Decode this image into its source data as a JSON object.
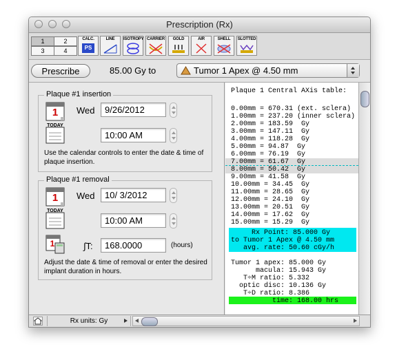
{
  "window": {
    "title": "Prescription (Rx)"
  },
  "toolbar": {
    "numbers": [
      "1",
      "2",
      "3",
      "4"
    ],
    "tools": [
      {
        "label": "CALC.",
        "sub": "PS",
        "icon": "calc-ps-icon"
      },
      {
        "label": "LINE",
        "icon": "line-icon"
      },
      {
        "label": "ISOTROPY",
        "icon": "isotropy-icon"
      },
      {
        "label": "CARRIER",
        "icon": "carrier-icon"
      },
      {
        "label": "GOLD",
        "icon": "gold-icon"
      },
      {
        "label": "AIR",
        "icon": "air-icon"
      },
      {
        "label": "SHELL",
        "icon": "shell-icon"
      },
      {
        "label": "SLOTTED",
        "icon": "slotted-icon"
      }
    ]
  },
  "rx": {
    "prescribe_label": "Prescribe",
    "dose_text": "85.00  Gy to",
    "target": "Tumor 1 Apex @ 4.50 mm"
  },
  "insertion": {
    "title": "Plaque #1 insertion",
    "weekday": "Wed",
    "date": "9/26/2012",
    "time": "10:00 AM",
    "cal_day": "1",
    "today_label": "TODAY",
    "help": "Use the calendar controls to enter the date & time of plaque insertion."
  },
  "removal": {
    "title": "Plaque #1 removal",
    "weekday": "Wed",
    "date": "10/ 3/2012",
    "time": "10:00 AM",
    "cal_day": "1",
    "today_label": "TODAY",
    "duration_label": "∫T:",
    "duration": "168.0000",
    "duration_unit": "(hours)",
    "help": "Adjust the date & time of removal or enter the desired implant duration in hours."
  },
  "axis_table": {
    "title": "Plaque 1 Central AXis table:",
    "rows": [
      "0.00mm = 670.31 (ext. sclera)",
      "1.00mm = 237.20 (inner sclera)",
      "2.00mm = 183.59  Gy",
      "3.00mm = 147.11  Gy",
      "4.00mm = 118.28  Gy",
      "5.00mm = 94.87  Gy",
      "6.00mm = 76.19  Gy",
      "7.00mm = 61.67  Gy",
      "8.00mm = 50.42  Gy",
      "9.00mm = 41.58  Gy",
      "10.00mm = 34.45  Gy",
      "11.00mm = 28.65  Gy",
      "12.00mm = 24.10  Gy",
      "13.00mm = 20.51  Gy",
      "14.00mm = 17.62  Gy",
      "15.00mm = 15.29  Gy"
    ],
    "rx_point": [
      "     Rx Point: 85.000 Gy",
      "to Tumor 1 Apex @ 4.50 mm",
      "   avg. rate: 50.60 cGy/h"
    ],
    "summary": [
      "Tumor 1 apex: 85.000 Gy",
      "      macula: 15.943 Gy",
      "   T÷M ratio: 5.332",
      "  optic disc: 10.136 Gy",
      "   T÷D ratio: 8.386",
      "          time: 168.00 hrs"
    ]
  },
  "status": {
    "units": "Rx units: Gy"
  },
  "colors": {
    "highlight_cyan": "#00e8f0",
    "highlight_green": "#1bf21b"
  }
}
